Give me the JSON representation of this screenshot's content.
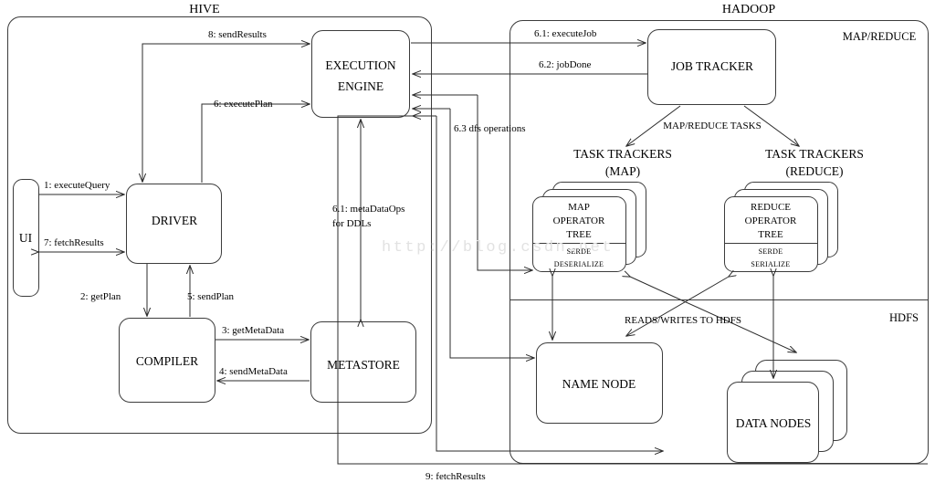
{
  "diagram": {
    "title_left": "HIVE",
    "title_right": "HADOOP",
    "watermark": "http://blog.csdn.net"
  },
  "hive": {
    "label": "HIVE",
    "nodes": {
      "ui": "UI",
      "driver": "DRIVER",
      "execution_engine_line1": "EXECUTION",
      "execution_engine_line2": "ENGINE",
      "compiler": "COMPILER",
      "metastore": "METASTORE"
    },
    "edges": {
      "execute_query": "1: executeQuery",
      "get_plan": "2: getPlan",
      "get_metadata": "3: getMetaData",
      "send_metadata": "4: sendMetaData",
      "send_plan": "5: sendPlan",
      "execute_plan": "6: executePlan",
      "fetch_results": "7: fetchResults",
      "send_results": "8: sendResults",
      "metadata_ops_line1": "6.1: metaDataOps",
      "metadata_ops_line2": "for DDLs"
    }
  },
  "hadoop": {
    "label": "HADOOP",
    "mapreduce_label": "MAP/REDUCE",
    "hdfs_label": "HDFS",
    "nodes": {
      "job_tracker": "JOB TRACKER",
      "task_trackers_map_line1": "TASK TRACKERS",
      "task_trackers_map_line2": "(MAP)",
      "task_trackers_reduce_line1": "TASK TRACKERS",
      "task_trackers_reduce_line2": "(REDUCE)",
      "map_operator_tree_line1": "MAP",
      "map_operator_tree_line2": "OPERATOR",
      "map_operator_tree_line3": "TREE",
      "map_serde_line1": "SERDE",
      "map_serde_line2": "DESERIALIZE",
      "reduce_operator_tree_line1": "REDUCE",
      "reduce_operator_tree_line2": "OPERATOR",
      "reduce_operator_tree_line3": "TREE",
      "reduce_serde_line1": "SERDE",
      "reduce_serde_line2": "SERIALIZE",
      "name_node": "NAME NODE",
      "data_nodes": "DATA NODES"
    },
    "edges": {
      "execute_job": "6.1: executeJob",
      "job_done": "6.2: jobDone",
      "dfs_operations": "6.3 dfs operations",
      "mapreduce_tasks": "MAP/REDUCE TASKS",
      "reads_writes_hdfs": "READS/WRITES TO HDFS",
      "fetch_results_9": "9: fetchResults"
    }
  },
  "colors": {
    "stroke": "#3c3c3c",
    "connector": "#2b2b2b",
    "background": "#ffffff",
    "watermark": "#e2e2e2"
  }
}
